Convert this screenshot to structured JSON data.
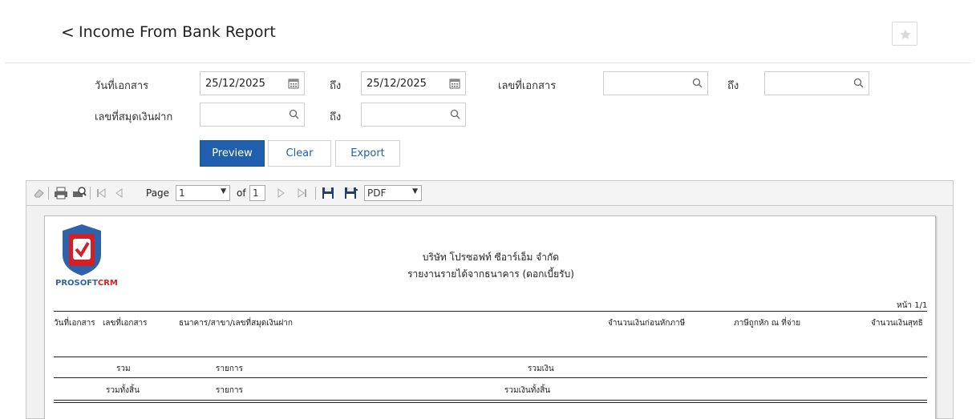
{
  "header": {
    "back_glyph": "<",
    "title": "Income From Bank Report",
    "star_icon": "star-icon"
  },
  "filters": {
    "doc_date_label": "วันที่เอกสาร",
    "date_from": "25/12/2025",
    "to_label": "ถึง",
    "date_to": "25/12/2025",
    "doc_no_label": "เลขที่เอกสาร",
    "doc_no_from": "",
    "doc_no_to": "",
    "passbook_label": "เลขที่สมุดเงินฝาก",
    "passbook_from": "",
    "passbook_to": ""
  },
  "buttons": {
    "preview": "Preview",
    "clear": "Clear",
    "export": "Export"
  },
  "toolbar": {
    "page_label": "Page",
    "page_value": "1",
    "of_label": "of",
    "total_pages": "1",
    "format": "PDF"
  },
  "report": {
    "logo_part1": "PROSOFT",
    "logo_part2": "CRM",
    "company": "บริษัท โปรซอฟท์ ซีอาร์เอ็ม จำกัด",
    "report_title": "รายงานรายได้จากธนาคาร (ดอกเบี้ยรับ)",
    "page_info": "หน้า 1/1",
    "columns": {
      "doc_date": "วันที่เอกสาร",
      "doc_no": "เลขที่เอกสาร",
      "bank": "ธนาคาร/สาขา/เลขที่สมุดเงินฝาก",
      "amount_before_tax": "จำนวนเงินก่อนหักภาษี",
      "withholding_tax": "ภาษีถูกหัก ณ ที่จ่าย",
      "net_amount": "จำนวนเงินสุทธิ"
    },
    "summary": {
      "total": "รวม",
      "items": "รายการ",
      "total_amount": "รวมเงิน",
      "grand_total": "รวมทั้งสิ้น",
      "grand_items": "รายการ",
      "grand_total_amount": "รวมเงินทั้งสิ้น"
    }
  },
  "colors": {
    "primary": "#1f5fad",
    "logo_red": "#d32027",
    "logo_blue": "#2f62a8"
  }
}
